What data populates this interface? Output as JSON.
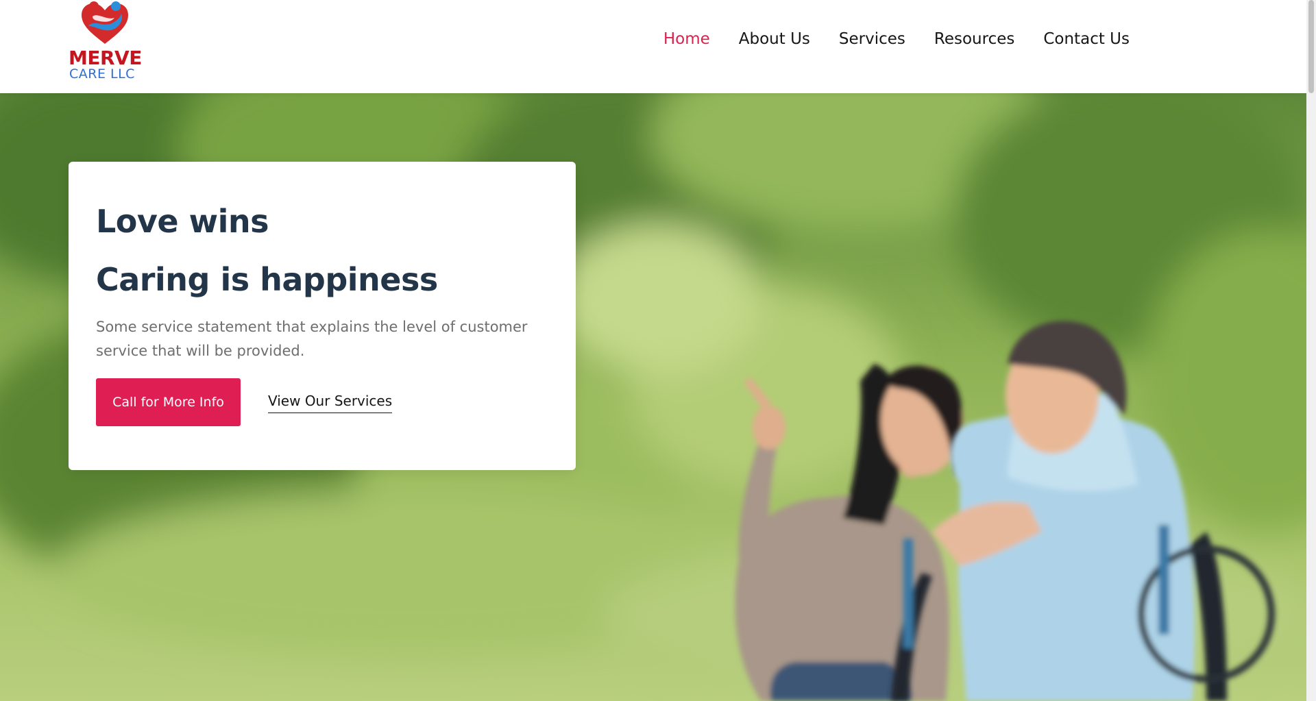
{
  "brand": {
    "name_line1": "MERVE",
    "name_line2": "CARE LLC",
    "logo_icon": "heart-family-icon",
    "colors": {
      "red": "#c5161f",
      "blue": "#2e6fd1"
    }
  },
  "nav": {
    "items": [
      {
        "label": "Home",
        "active": true
      },
      {
        "label": "About Us",
        "active": false
      },
      {
        "label": "Services",
        "active": false
      },
      {
        "label": "Resources",
        "active": false
      },
      {
        "label": "Contact Us",
        "active": false
      }
    ],
    "active_color": "#d9234d"
  },
  "hero": {
    "headline_1": "Love wins",
    "headline_2": "Caring is happiness",
    "statement": "Some service statement that explains the level of customer service that will be provided.",
    "primary_button": "Call for More Info",
    "secondary_link": "View Our Services",
    "accent_color": "#df1e54"
  }
}
